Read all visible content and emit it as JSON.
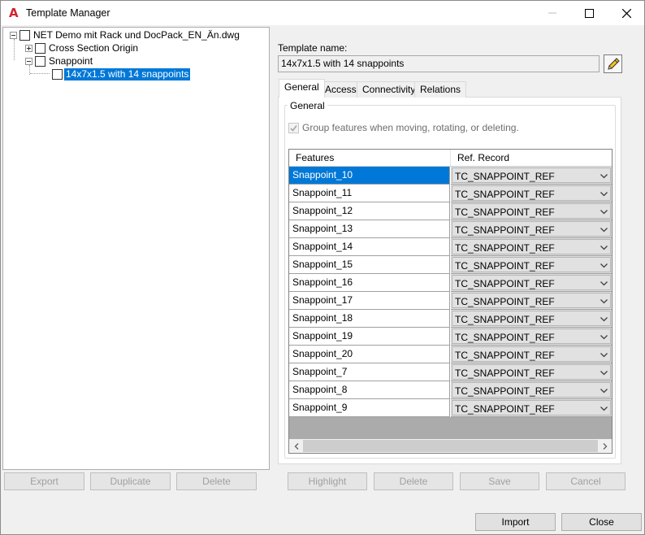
{
  "window": {
    "title": "Template Manager",
    "app_icon_glyph": "A",
    "accent_color": "#d1242f",
    "selection_color": "#0078d7"
  },
  "tree": {
    "root": {
      "label": "NET Demo mit Rack und DocPack_EN_Än.dwg",
      "expanded": true,
      "checked": false
    },
    "children": [
      {
        "label": "Cross Section Origin",
        "expanded": false,
        "checked": false
      },
      {
        "label": "Snappoint",
        "expanded": true,
        "checked": false,
        "children": [
          {
            "label": "14x7x1.5 with 14 snappoints",
            "checked": false,
            "selected": true
          }
        ]
      }
    ]
  },
  "left_buttons": {
    "export": "Export",
    "duplicate": "Duplicate",
    "delete": "Delete"
  },
  "template_name": {
    "label": "Template name:",
    "value": "14x7x1.5 with 14 snappoints"
  },
  "tabs": [
    {
      "label": "General",
      "active": true
    },
    {
      "label": "Access",
      "active": false
    },
    {
      "label": "Connectivity",
      "active": false
    },
    {
      "label": "Relations",
      "active": false
    }
  ],
  "general": {
    "group_title": "General",
    "group_checkbox": {
      "label": "Group features when moving, rotating, or deleting.",
      "checked": true,
      "enabled": false
    }
  },
  "grid": {
    "columns": [
      "Features",
      "Ref. Record"
    ],
    "rows": [
      {
        "feature": "Snappoint_10",
        "ref": "TC_SNAPPOINT_REF",
        "selected": true
      },
      {
        "feature": "Snappoint_11",
        "ref": "TC_SNAPPOINT_REF"
      },
      {
        "feature": "Snappoint_12",
        "ref": "TC_SNAPPOINT_REF"
      },
      {
        "feature": "Snappoint_13",
        "ref": "TC_SNAPPOINT_REF"
      },
      {
        "feature": "Snappoint_14",
        "ref": "TC_SNAPPOINT_REF"
      },
      {
        "feature": "Snappoint_15",
        "ref": "TC_SNAPPOINT_REF"
      },
      {
        "feature": "Snappoint_16",
        "ref": "TC_SNAPPOINT_REF"
      },
      {
        "feature": "Snappoint_17",
        "ref": "TC_SNAPPOINT_REF"
      },
      {
        "feature": "Snappoint_18",
        "ref": "TC_SNAPPOINT_REF"
      },
      {
        "feature": "Snappoint_19",
        "ref": "TC_SNAPPOINT_REF"
      },
      {
        "feature": "Snappoint_20",
        "ref": "TC_SNAPPOINT_REF"
      },
      {
        "feature": "Snappoint_7",
        "ref": "TC_SNAPPOINT_REF"
      },
      {
        "feature": "Snappoint_8",
        "ref": "TC_SNAPPOINT_REF"
      },
      {
        "feature": "Snappoint_9",
        "ref": "TC_SNAPPOINT_REF"
      }
    ]
  },
  "right_buttons": {
    "highlight": "Highlight",
    "delete": "Delete",
    "save": "Save",
    "cancel": "Cancel"
  },
  "footer_buttons": {
    "import": "Import",
    "close": "Close"
  },
  "icons": {
    "app": "autocad-app-icon",
    "minimize": "minimize-icon",
    "maximize": "maximize-icon",
    "close": "close-icon",
    "edit": "pencil-icon",
    "dropdown": "chevron-down-icon",
    "scroll_left": "chevron-left-icon",
    "scroll_right": "chevron-right-icon"
  }
}
